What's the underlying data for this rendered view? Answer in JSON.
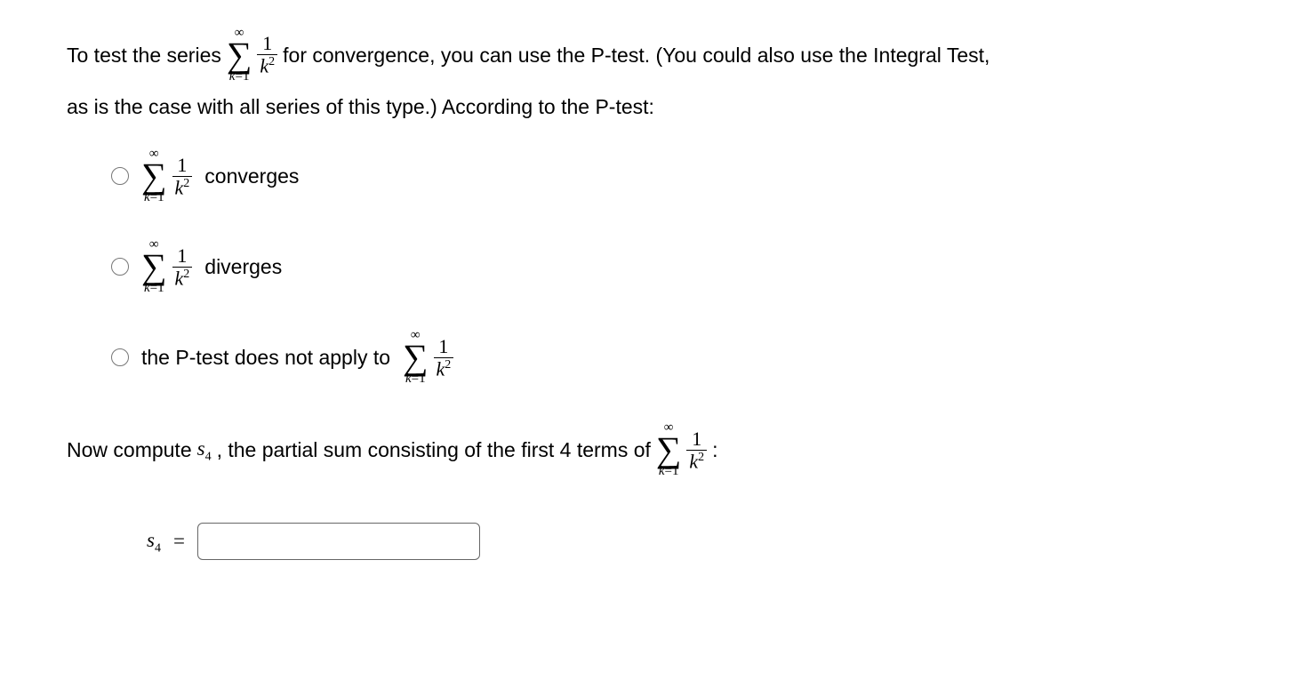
{
  "intro": {
    "part1": "To test the series",
    "part2": "for convergence, you can use the P-test. (You could also use the Integral Test,",
    "part3": "as is the case with all series of this type.) According to the P-test:"
  },
  "sumExpr": {
    "upper": "∞",
    "lowerVar": "k",
    "lowerEq": "=",
    "lowerVal": "1",
    "fracNum": "1",
    "fracDenVar": "k",
    "fracDenExp": "2"
  },
  "options": {
    "a": "converges",
    "b": "diverges",
    "c": "the P-test does not apply to"
  },
  "partial": {
    "prefix": "Now compute ",
    "sVar": "s",
    "sIndex": "4",
    "mid": ", the partial sum consisting of the first 4 terms of",
    "colon": ":"
  },
  "answer": {
    "labelVar": "s",
    "labelSub": "4",
    "eq": "="
  }
}
